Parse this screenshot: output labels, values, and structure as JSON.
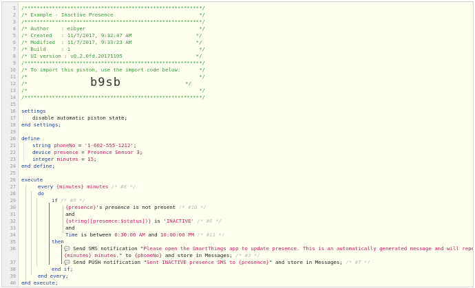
{
  "line_numbers": [
    "1",
    "2",
    "3",
    "4",
    "5",
    "6",
    "7",
    "8",
    "9",
    "10",
    "11",
    "12",
    "13",
    "14",
    "15",
    "16",
    "17",
    "18",
    "19",
    "20",
    "21",
    "22",
    "23",
    "24",
    "25",
    "26",
    "27",
    "28",
    "29",
    "30",
    "31",
    "32",
    "33",
    "34",
    "35",
    "36",
    "",
    "37",
    "38",
    "39",
    "40"
  ],
  "header": {
    "stars": "/**********************************************************/",
    "title": "/* Example - Inactive Presence                            */",
    "author": "/* Author    : eibyer                                     */",
    "created": "/* Created   : 11/7/2017, 9:32:47 AM                     */",
    "modified": "/* Modified  : 11/7/2017, 9:33:23 AM                     */",
    "build": "/* Build     : 1                                          */",
    "ui_version": "/* UI version : v0.2.0fd.20171105                        */",
    "import_note": "/* To import this piston, use the import code below:      */",
    "blank": "/*                                                        */",
    "import_line_prefix": "/*              ",
    "import_code": "b9sb",
    "import_line_suffix": "                                    */"
  },
  "settings": {
    "open": "settings",
    "item": "disable automatic piston state;",
    "close": "end settings;"
  },
  "define": {
    "open": "define",
    "var1": {
      "type": "string",
      "name": "phoneNo",
      "eq": " = ",
      "value": "'1-602-555-1212'",
      "end": ";"
    },
    "var2": {
      "type": "device",
      "name": "presence",
      "eq": " = ",
      "value": "Presence Sensor 3",
      "end": ";"
    },
    "var3": {
      "type": "integer",
      "name": "minutes",
      "eq": " = ",
      "value": "15",
      "end": ";"
    },
    "close": "end define;"
  },
  "execute": {
    "open": "execute",
    "every_kw": "every",
    "every_expr": "{minutes}",
    "every_unit": "minutes",
    "every_id": "/* #8 */",
    "do": "do",
    "if_kw": "if",
    "if_id": "/* #9 */",
    "cond1_expr": "{presence}",
    "cond1_text": "'s ",
    "cond1_attr": "presence",
    "cond1_rest": " is not present ",
    "cond1_id": "/* #10 */",
    "and1": "and",
    "cond2_expr": "{string([presence:$status])}",
    "cond2_is": " is ",
    "cond2_val": "'INACTIVE'",
    "cond2_id": "/* #6 */",
    "and2": "and",
    "cond3_time": "Time",
    "cond3_between": " is between ",
    "cond3_start": "6:30:00 AM",
    "cond3_and": " and ",
    "cond3_end": "10:00:00 PM",
    "cond3_id": "/* #11 */",
    "then": "then",
    "sms_icon": "💬",
    "sms_prefix": " Send SMS notification \"",
    "sms_msg": "Please open the SmartThings app to update presence. This is an automatically generated message and will repeat in",
    "sms_msg2": "{minutes} minutes.",
    "sms_mid": "\" to ",
    "sms_to": "{phoneNo}",
    "sms_suffix": " and store in Messages; ",
    "sms_id": "/* #3 */",
    "push_icon": "💬",
    "push_prefix": " Send PUSH notification \"",
    "push_msg": "Sent INACTIVE presence SMS to {presence}",
    "push_suffix": "\" and store in Messages; ",
    "push_id": "/* #7 */",
    "end_if": "end if;",
    "end_every": "end every;",
    "close": "end execute;"
  },
  "colors": {
    "comment": "#3c9a3c",
    "keyword": "#1f3f8f",
    "value": "#c02060",
    "id": "#bdbdbd",
    "background": "#fffff0"
  }
}
